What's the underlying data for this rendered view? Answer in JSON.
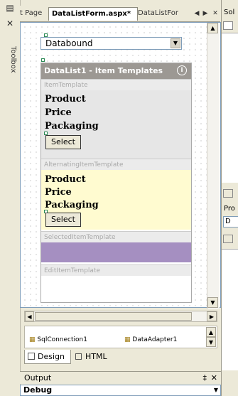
{
  "toolbox": {
    "label": "Toolbox",
    "icons": [
      "server-explorer-icon",
      "toolbox-icon"
    ]
  },
  "tabs": {
    "items": [
      "t Page",
      "DataListForm.aspx*",
      "DataListFor"
    ],
    "nav_left": "◀",
    "nav_right": "▶",
    "close": "✕"
  },
  "designer": {
    "dropdown_value": "Databound",
    "datalist_title": "DataList1 - Item Templates",
    "info_glyph": "i",
    "templates": [
      {
        "name": "ItemTemplate",
        "fields": [
          "Product",
          "Price",
          "Packaging"
        ],
        "button": "Select",
        "bg": "#e6e6e6"
      },
      {
        "name": "AlternatingItemTemplate",
        "fields": [
          "Product",
          "Price",
          "Packaging"
        ],
        "button": "Select",
        "bg": "#fffbd0"
      },
      {
        "name": "SelectedItemTemplate",
        "fields": [],
        "button": "",
        "bg": "#a58fc1"
      },
      {
        "name": "EditItemTemplate",
        "fields": [],
        "button": "",
        "bg": "#ffffff"
      }
    ]
  },
  "tray": {
    "items": [
      "SqlConnection1",
      "DataAdapter1"
    ]
  },
  "view_tabs": {
    "design": "Design",
    "html": "HTML"
  },
  "output": {
    "title": "Output",
    "pin": "‡",
    "close": "✕",
    "dropdown_value": "Debug"
  },
  "right_panel": {
    "labels": [
      "Sol",
      "Pro",
      "D"
    ]
  },
  "colors": {
    "header_bg": "#9c9893",
    "selected_bg": "#a58fc1",
    "alt_bg": "#fffbd0",
    "item_bg": "#e6e6e6"
  }
}
